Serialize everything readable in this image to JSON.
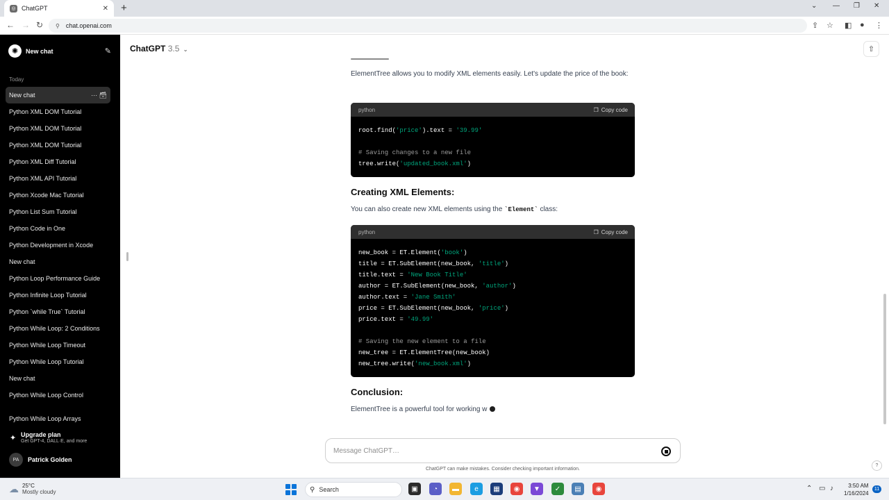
{
  "browser": {
    "tab_title": "ChatGPT",
    "url": "chat.openai.com"
  },
  "sidebar": {
    "new_chat_label": "New chat",
    "section_label": "Today",
    "chats": [
      "New chat",
      "Python XML DOM Tutorial",
      "Python XML DOM Tutorial",
      "Python XML DOM Tutorial",
      "Python XML Diff Tutorial",
      "Python XML API Tutorial",
      "Python Xcode Mac Tutorial",
      "Python List Sum Tutorial",
      "Python Code in One",
      "Python Development in Xcode",
      "New chat",
      "Python Loop Performance Guide",
      "Python Infinite Loop Tutorial",
      "Python `while True` Tutorial",
      "Python While Loop: 2 Conditions",
      "Python While Loop Timeout",
      "Python While Loop Tutorial",
      "New chat",
      "Python While Loop Control",
      "Python While Loop Arrays"
    ],
    "upgrade": {
      "title": "Upgrade plan",
      "subtitle": "Get GPT-4, DALL·E, and more"
    },
    "user": {
      "initials": "PA",
      "name": "Patrick Golden"
    }
  },
  "header": {
    "model_name": "ChatGPT",
    "model_version": "3.5"
  },
  "content": {
    "para1": "ElementTree allows you to modify XML elements easily. Let's update the price of the book:",
    "code1": {
      "lang": "python",
      "copy_label": "Copy code",
      "lines": [
        [
          {
            "t": "root.find(",
            "c": ""
          },
          {
            "t": "'price'",
            "c": "str"
          },
          {
            "t": ").text = ",
            "c": ""
          },
          {
            "t": "'39.99'",
            "c": "str"
          }
        ],
        [],
        [
          {
            "t": "# Saving changes to a new file",
            "c": "cmt"
          }
        ],
        [
          {
            "t": "tree.write(",
            "c": ""
          },
          {
            "t": "'updated_book.xml'",
            "c": "str"
          },
          {
            "t": ")",
            "c": ""
          }
        ]
      ]
    },
    "heading1": "Creating XML Elements:",
    "para2_prefix": "You can also create new XML elements using the ",
    "para2_code": "`Element`",
    "para2_suffix": " class:",
    "code2": {
      "lang": "python",
      "copy_label": "Copy code",
      "lines": [
        [
          {
            "t": "new_book = ET.Element(",
            "c": ""
          },
          {
            "t": "'book'",
            "c": "str"
          },
          {
            "t": ")",
            "c": ""
          }
        ],
        [
          {
            "t": "title = ET.SubElement(new_book, ",
            "c": ""
          },
          {
            "t": "'title'",
            "c": "str"
          },
          {
            "t": ")",
            "c": ""
          }
        ],
        [
          {
            "t": "title.text = ",
            "c": ""
          },
          {
            "t": "'New Book Title'",
            "c": "str"
          }
        ],
        [
          {
            "t": "author = ET.SubElement(new_book, ",
            "c": ""
          },
          {
            "t": "'author'",
            "c": "str"
          },
          {
            "t": ")",
            "c": ""
          }
        ],
        [
          {
            "t": "author.text = ",
            "c": ""
          },
          {
            "t": "'Jane Smith'",
            "c": "str"
          }
        ],
        [
          {
            "t": "price = ET.SubElement(new_book, ",
            "c": ""
          },
          {
            "t": "'price'",
            "c": "str"
          },
          {
            "t": ")",
            "c": ""
          }
        ],
        [
          {
            "t": "price.text = ",
            "c": ""
          },
          {
            "t": "'49.99'",
            "c": "str"
          }
        ],
        [],
        [
          {
            "t": "# Saving the new element to a file",
            "c": "cmt"
          }
        ],
        [
          {
            "t": "new_tree = ET.ElementTree(new_book)",
            "c": ""
          }
        ],
        [
          {
            "t": "new_tree.write(",
            "c": ""
          },
          {
            "t": "'new_book.xml'",
            "c": "str"
          },
          {
            "t": ")",
            "c": ""
          }
        ]
      ]
    },
    "heading2": "Conclusion:",
    "para3": "ElementTree is a powerful tool for working w"
  },
  "composer": {
    "placeholder": "Message ChatGPT…",
    "disclaimer": "ChatGPT can make mistakes. Consider checking important information."
  },
  "taskbar": {
    "temperature": "25°C",
    "weather": "Mostly cloudy",
    "search_label": "Search",
    "time": "3:50 AM",
    "date": "1/16/2024",
    "notification_count": "11"
  },
  "colors": {
    "sidebar_bg": "#000000",
    "code_bg": "#000000",
    "code_header_bg": "#2f2f2f",
    "code_string": "#00a67d",
    "code_comment": "#9b9b9b",
    "windows_accent": "#0a74d9"
  },
  "icons": {
    "logo": "openai-logo-icon",
    "edit": "new-chat-edit-icon",
    "share": "share-icon",
    "copy": "clipboard-icon",
    "stop": "stop-generating-icon"
  }
}
